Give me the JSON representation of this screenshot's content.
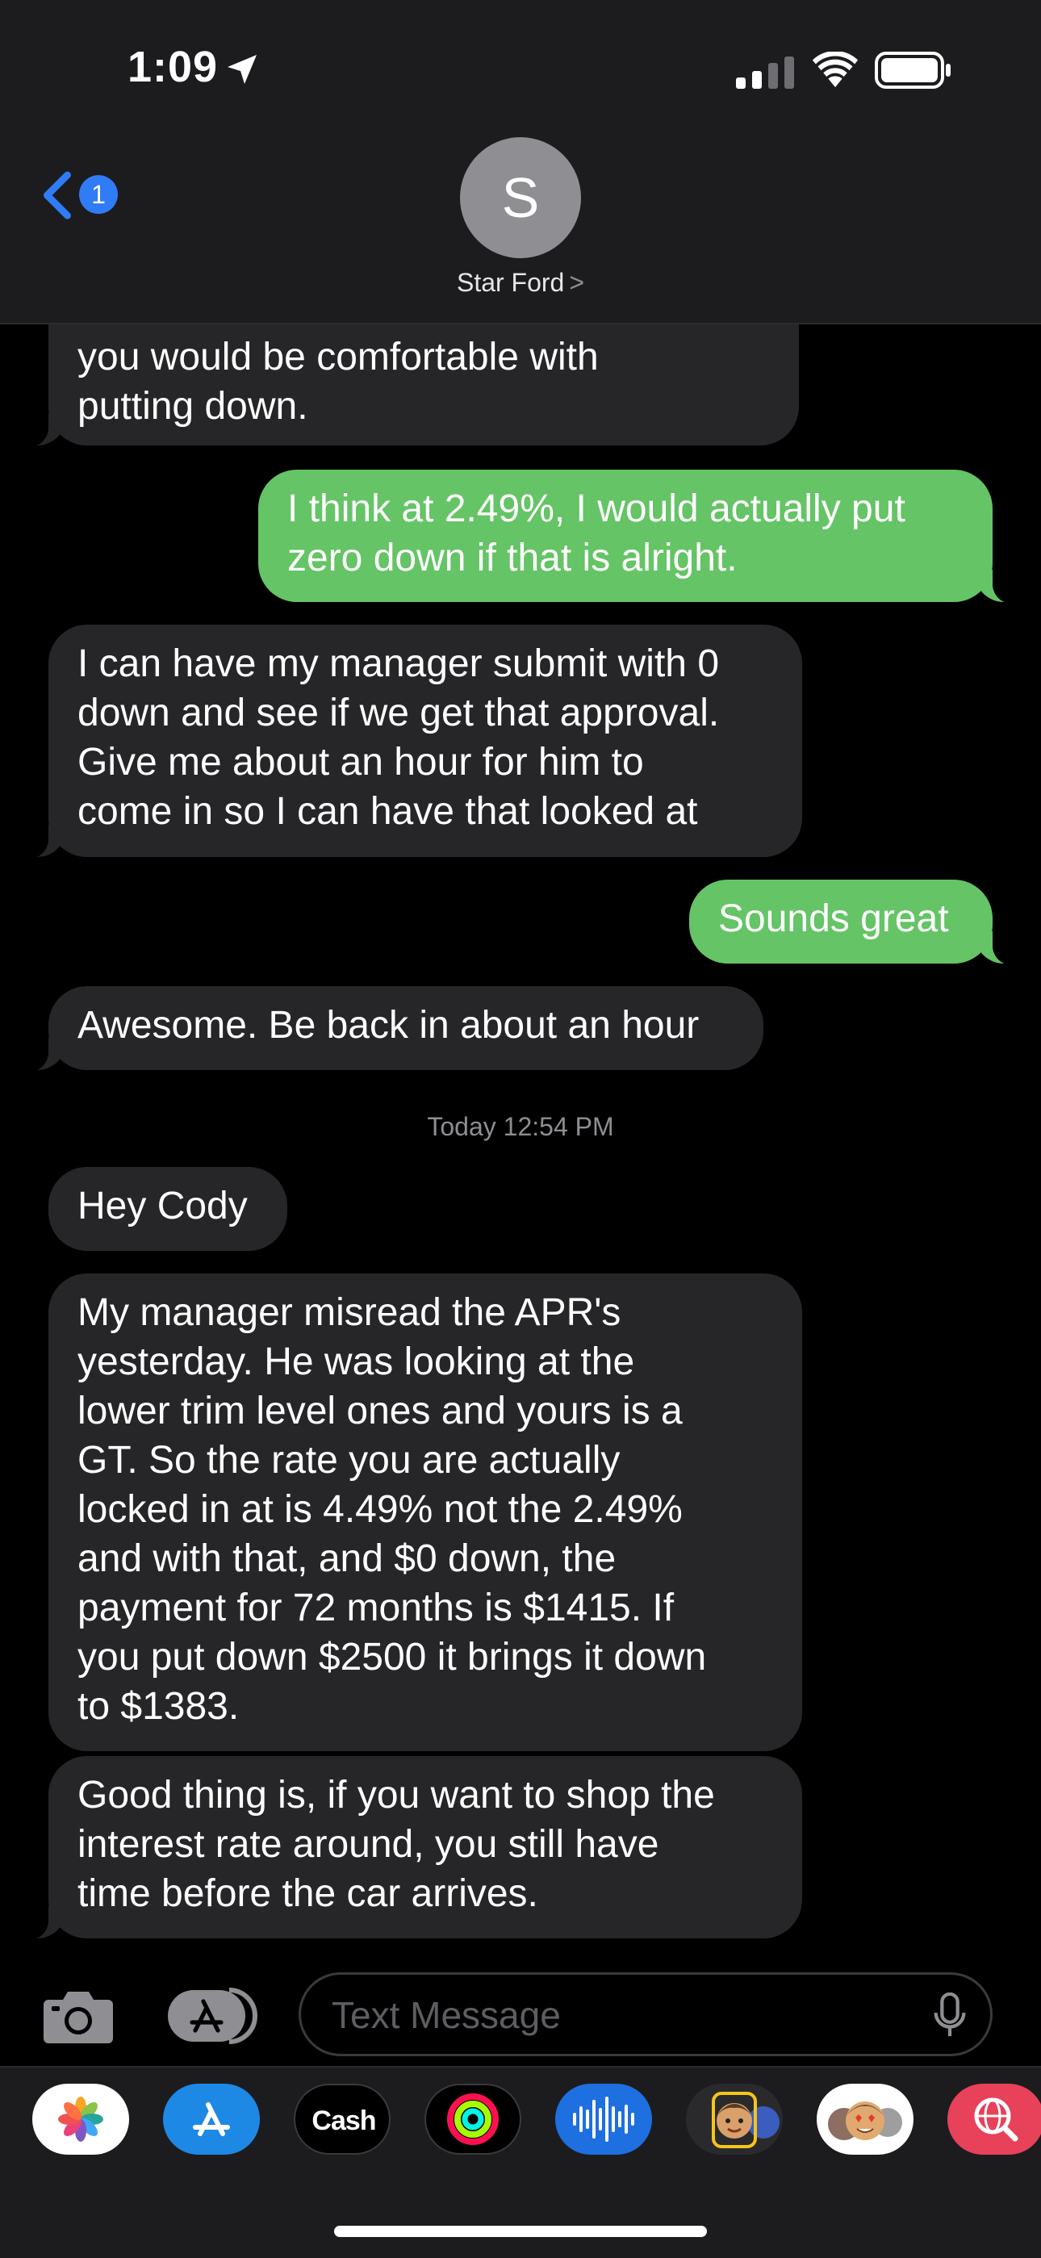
{
  "status_bar": {
    "time": "1:09"
  },
  "header": {
    "back_badge": "1",
    "avatar_initial": "S",
    "contact_name": "Star Ford",
    "contact_chevron": ">"
  },
  "messages": [
    {
      "direction": "in",
      "lines": [
        "you would be comfortable with",
        "putting down."
      ]
    },
    {
      "direction": "out",
      "lines": [
        "I think at 2.49%, I would actually put",
        "zero down if that is alright."
      ]
    },
    {
      "direction": "in",
      "lines": [
        "I can have my manager submit with 0",
        "down and see if we get that approval.",
        "Give me about an hour for him to",
        "come in so I can have that looked at"
      ]
    },
    {
      "direction": "out",
      "lines": [
        "Sounds great"
      ]
    },
    {
      "direction": "in",
      "lines": [
        "Awesome. Be back in about an hour"
      ]
    },
    {
      "direction": "in",
      "lines": [
        "Hey Cody"
      ]
    },
    {
      "direction": "in",
      "lines": [
        "My manager misread the APR's",
        "yesterday. He was looking at the",
        "lower trim level ones and yours is a",
        "GT. So the rate you are actually",
        "locked in at is 4.49% not the 2.49%",
        "and with that, and $0 down, the",
        "payment for 72 months is $1415. If",
        "you put down $2500 it brings it down",
        "to $1383."
      ]
    },
    {
      "direction": "in",
      "lines": [
        "Good thing is, if you want to shop the",
        "interest rate around, you still have",
        "time before the car arrives."
      ]
    }
  ],
  "timestamp": {
    "day": "Today",
    "time": "12:54 PM"
  },
  "input_bar": {
    "placeholder": "Text Message"
  },
  "app_drawer": {
    "items": [
      {
        "name": "Photos",
        "icon": "photos-icon"
      },
      {
        "name": "App Store",
        "icon": "app-store-icon"
      },
      {
        "name": "Apple Cash",
        "icon": "apple-cash-icon",
        "label": "Cash"
      },
      {
        "name": "Activity",
        "icon": "activity-icon"
      },
      {
        "name": "Audio Message",
        "icon": "audio-waveform-icon"
      },
      {
        "name": "Memoji",
        "icon": "memoji-icon"
      },
      {
        "name": "Memoji Stickers",
        "icon": "memoji-stickers-icon"
      },
      {
        "name": "Image Search",
        "icon": "globe-search-icon"
      }
    ]
  },
  "colors": {
    "incoming_bubble": "#262628",
    "outgoing_bubble": "#65c466",
    "accent_blue": "#2f7cf6"
  }
}
